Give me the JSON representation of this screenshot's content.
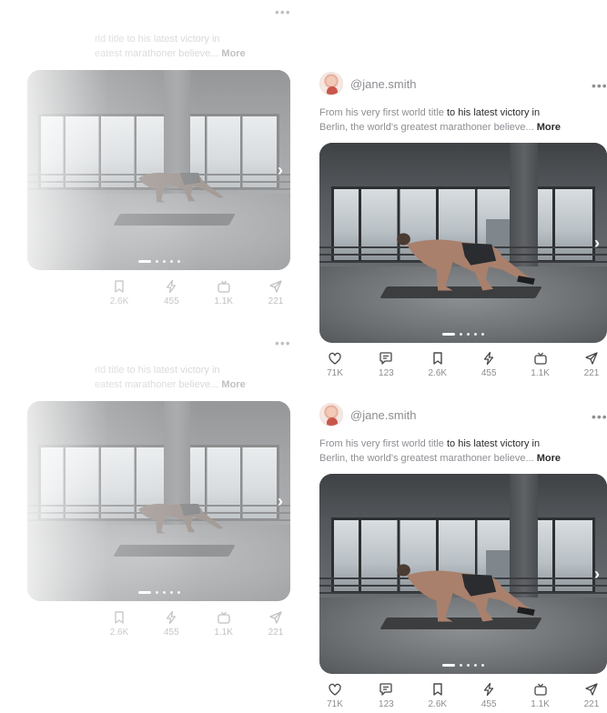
{
  "post": {
    "handle": "@jane.smith",
    "more_menu": "•••",
    "caption_start": "From his very first world title ",
    "caption_mid": "to his latest victory in",
    "caption_line2": "Berlin, the world's greatest marathoner believe... ",
    "caption_more": "More",
    "chevron": "›",
    "actions": {
      "likes": "71K",
      "comments": "123",
      "saves": "2.6K",
      "boosts": "455",
      "views": "1.1K",
      "shares": "221"
    }
  },
  "ghost": {
    "caption_line1": "rld title to his latest victory in",
    "caption_line2": "eatest marathoner believe... ",
    "caption_more": "More",
    "more_menu": "•••",
    "chevron": "›",
    "actions": {
      "saves": "2.6K",
      "boosts": "455",
      "views": "1.1K",
      "shares": "221"
    }
  },
  "icons": [
    "heart-icon",
    "comment-icon",
    "bookmark-icon",
    "lightning-icon",
    "tv-icon",
    "send-icon",
    "chevron-right-icon",
    "more-horizontal-icon"
  ],
  "carousel": {
    "total_slides": 5,
    "active_slide": 1
  }
}
